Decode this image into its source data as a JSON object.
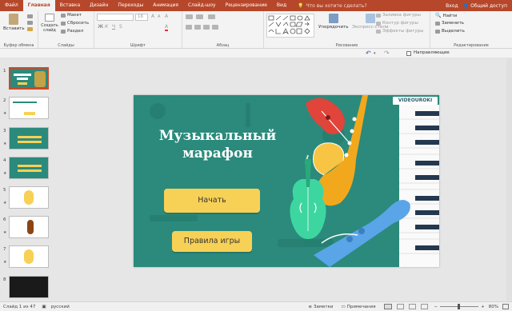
{
  "tabs": [
    "Файл",
    "Главная",
    "Вставка",
    "Дизайн",
    "Переходы",
    "Анимация",
    "Слайд-шоу",
    "Рецензирование",
    "Вид"
  ],
  "active_tab": "Главная",
  "tell_me": "Что вы хотите сделать?",
  "signin": "Вход",
  "share": "Общий доступ",
  "groups": {
    "clipboard": {
      "label": "Буфер обмена",
      "paste": "Вставить"
    },
    "slides": {
      "label": "Слайды",
      "create": "Создать слайд",
      "layout": "Макет",
      "reset": "Сбросить",
      "section": "Раздел"
    },
    "font": {
      "label": "Шрифт",
      "size": "16"
    },
    "paragraph": {
      "label": "Абзац"
    },
    "drawing": {
      "label": "Рисование",
      "arrange": "Упорядочить",
      "quick_styles": "Экспресс-стили",
      "fill": "Заливка фигуры",
      "outline": "Контур фигуры",
      "effects": "Эффекты фигуры"
    },
    "editing": {
      "label": "Редактирование",
      "find": "Найти",
      "replace": "Заменить",
      "select": "Выделить"
    }
  },
  "guides": "Направляющие",
  "thumbnails": [
    1,
    2,
    3,
    4,
    5,
    6,
    7,
    8
  ],
  "slide": {
    "title_line1": "Музыкальный",
    "title_line2": "марафон",
    "start_button": "Начать",
    "rules_button": "Правила игры",
    "logo": "VIDEOUROKI"
  },
  "status": {
    "slide_counter": "Слайд 1 из 47",
    "language": "русский",
    "notes": "Заметки",
    "comments": "Примечания",
    "zoom": "80%"
  },
  "colors": {
    "accent": "#b7472a",
    "slide_bg": "#2b8a7c",
    "button": "#f7d155"
  }
}
